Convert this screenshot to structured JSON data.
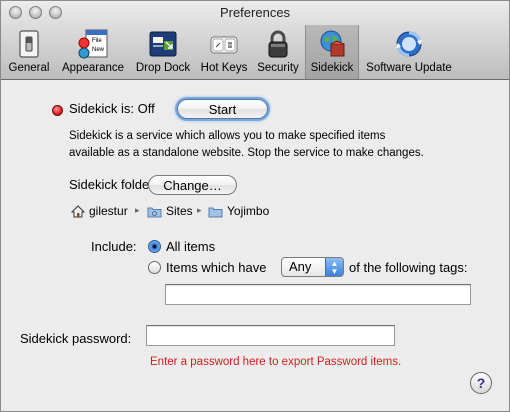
{
  "window": {
    "title": "Preferences"
  },
  "toolbar": {
    "items": [
      {
        "label": "General",
        "icon": "switch-icon"
      },
      {
        "label": "Appearance",
        "icon": "appearance-window-icon"
      },
      {
        "label": "Drop Dock",
        "icon": "drop-dock-icon"
      },
      {
        "label": "Hot Keys",
        "icon": "keyboard-keys-icon"
      },
      {
        "label": "Security",
        "icon": "padlock-icon"
      },
      {
        "label": "Sidekick",
        "icon": "globe-box-icon"
      },
      {
        "label": "Software Update",
        "icon": "update-arrows-icon"
      }
    ],
    "selected": "Sidekick",
    "appearance_icon_texts": [
      "File",
      "New"
    ]
  },
  "sidekick": {
    "status_label": "Sidekick is: Off",
    "status_color": "#e0242a",
    "start_button": "Start",
    "description_line1": "Sidekick is a service which allows you to make specified items",
    "description_line2": "available as a standalone website. Stop the service to make changes.",
    "folder_label": "Sidekick folder:",
    "change_button": "Change…",
    "path": [
      {
        "name": "gilestur",
        "icon": "home-icon"
      },
      {
        "name": "Sites",
        "icon": "folder-sites-icon"
      },
      {
        "name": "Yojimbo",
        "icon": "folder-icon"
      }
    ],
    "path_separator": "▸",
    "include_label": "Include:",
    "include_options": {
      "all": "All items",
      "tagged_prefix": "Items which have",
      "tagged_suffix": "of the following tags:"
    },
    "include_selected": "all",
    "tag_match_value": "Any",
    "tags_value": "",
    "password_label": "Sidekick password:",
    "password_value": "",
    "password_warning": "Enter a password here to export Password items.",
    "warning_color": "#d81b1b",
    "help_button": "?"
  }
}
